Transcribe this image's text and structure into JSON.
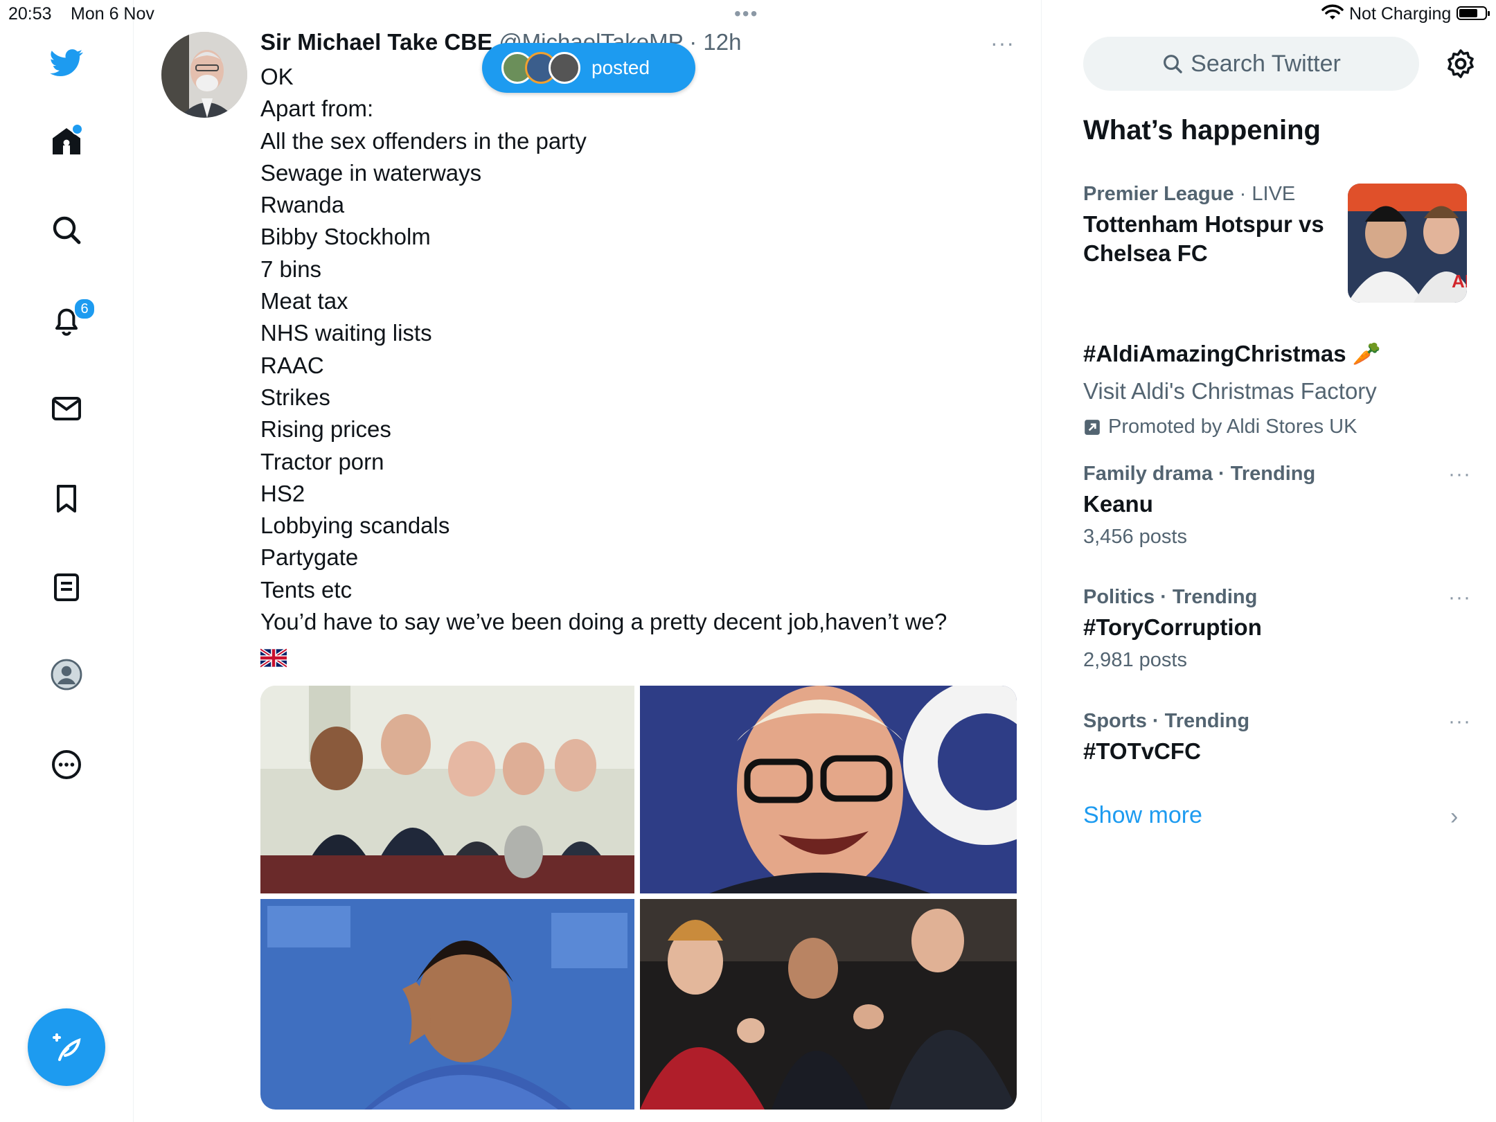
{
  "status_bar": {
    "time": "20:53",
    "date": "Mon 6 Nov",
    "multitask_dots": "•••",
    "charging": "Not Charging",
    "wifi_icon": "wifi-icon",
    "battery_icon": "battery-icon"
  },
  "nav": {
    "items": [
      {
        "name": "twitter-logo",
        "icon": "bird-icon"
      },
      {
        "name": "home",
        "icon": "home-icon",
        "has_dot": true
      },
      {
        "name": "explore",
        "icon": "search-icon"
      },
      {
        "name": "notifications",
        "icon": "bell-icon"
      },
      {
        "name": "messages",
        "icon": "mail-icon"
      },
      {
        "name": "bookmarks",
        "icon": "bookmark-icon"
      },
      {
        "name": "lists",
        "icon": "list-icon"
      },
      {
        "name": "profile",
        "icon": "avatar-icon"
      },
      {
        "name": "more",
        "icon": "more-circle-icon"
      }
    ],
    "notification_count": "6",
    "compose_icon": "compose-feather-icon",
    "accent": "#1d9bf0"
  },
  "tweet": {
    "name": "Sir Michael Take CBE",
    "handle": "@MichaelTakeMP",
    "separator": "·",
    "time": "12h",
    "more": "···",
    "lines": [
      "OK",
      "Apart from:",
      "All the sex offenders in the party",
      "Sewage in waterways",
      "Rwanda",
      "Bibby Stockholm",
      "7 bins",
      "Meat tax",
      "NHS waiting lists",
      "RAAC",
      "Strikes",
      "Rising prices",
      "Tractor porn",
      "HS2",
      "Lobbying scandals",
      "Partygate",
      "Tents etc",
      "You’d have to say we’ve been doing  a pretty decent job,haven’t we?"
    ],
    "flag_icon": "uk-flag-icon"
  },
  "new_posts_pill": {
    "arrow": "↑",
    "label": "posted"
  },
  "sidebar": {
    "search_placeholder": "Search Twitter",
    "settings_icon": "gear-icon",
    "section_title": "What’s happening",
    "trends": [
      {
        "category": "Premier League",
        "separator": " · ",
        "status": "LIVE",
        "title": "Tottenham Hotspur vs Chelsea FC"
      },
      {
        "title": "#AldiAmazingChristmas",
        "emoji": "🥕",
        "subtitle": "Visit Aldi's Christmas Factory",
        "promoted": "Promoted by Aldi Stores UK"
      },
      {
        "category": "Family drama · Trending",
        "title": "Keanu",
        "count": "3,456 posts",
        "more": "···"
      },
      {
        "category": "Politics · Trending",
        "title": "#ToryCorruption",
        "count": "2,981 posts",
        "more": "···"
      },
      {
        "category": "Sports · Trending",
        "title": "#TOTvCFC",
        "more": "···"
      }
    ],
    "show_more": "Show more",
    "chevron": "›"
  }
}
